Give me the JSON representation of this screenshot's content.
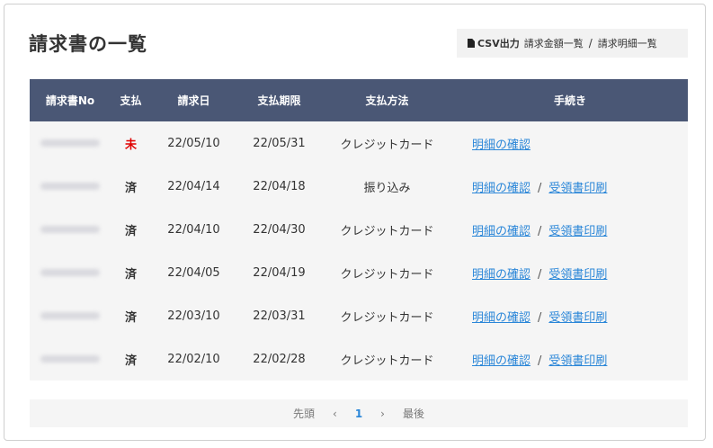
{
  "page_title": "請求書の一覧",
  "toolbar": {
    "csv_label": "CSV出力",
    "amount_list": "請求金額一覧",
    "separator": "/",
    "detail_list": "請求明細一覧"
  },
  "table": {
    "headers": [
      "請求書No",
      "支払",
      "請求日",
      "支払期限",
      "支払方法",
      "手続き"
    ],
    "rows": [
      {
        "status": "未",
        "date": "22/05/10",
        "due": "22/05/31",
        "method": "クレジットカード",
        "detail": "明細の確認",
        "receipt": ""
      },
      {
        "status": "済",
        "date": "22/04/14",
        "due": "22/04/18",
        "method": "振り込み",
        "detail": "明細の確認",
        "receipt": "受領書印刷"
      },
      {
        "status": "済",
        "date": "22/04/10",
        "due": "22/04/30",
        "method": "クレジットカード",
        "detail": "明細の確認",
        "receipt": "受領書印刷"
      },
      {
        "status": "済",
        "date": "22/04/05",
        "due": "22/04/19",
        "method": "クレジットカード",
        "detail": "明細の確認",
        "receipt": "受領書印刷"
      },
      {
        "status": "済",
        "date": "22/03/10",
        "due": "22/03/31",
        "method": "クレジットカード",
        "detail": "明細の確認",
        "receipt": "受領書印刷"
      },
      {
        "status": "済",
        "date": "22/02/10",
        "due": "22/02/28",
        "method": "クレジットカード",
        "detail": "明細の確認",
        "receipt": "受領書印刷"
      }
    ]
  },
  "pager": {
    "first": "先頭",
    "prev": "‹",
    "current": "1",
    "next": "›",
    "last": "最後"
  },
  "colors": {
    "header_bg": "#4a5775",
    "unpaid": "#e00000",
    "link": "#2a86d8"
  }
}
